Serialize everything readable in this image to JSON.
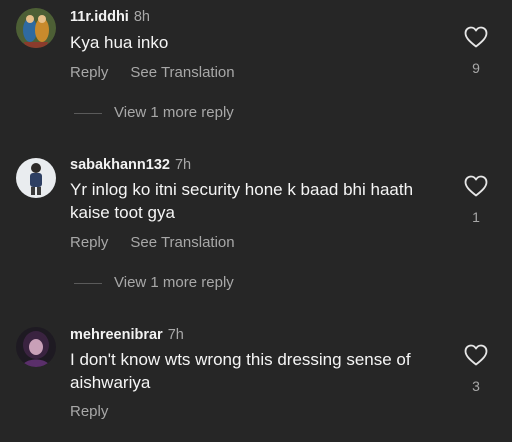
{
  "comments": [
    {
      "username": "11r.iddhi",
      "time": "8h",
      "text": "Kya hua inko",
      "reply_label": "Reply",
      "translate_label": "See Translation",
      "likes": "9",
      "view_replies": "View 1 more reply",
      "avatar_icon": "profile-photo"
    },
    {
      "username": "sabakhann132",
      "time": "7h",
      "text": "Yr inlog ko itni security hone k baad bhi haath kaise toot gya",
      "reply_label": "Reply",
      "translate_label": "See Translation",
      "likes": "1",
      "view_replies": "View 1 more reply",
      "avatar_icon": "profile-photo"
    },
    {
      "username": "mehreenibrar",
      "time": "7h",
      "text": "I don't know wts wrong this dressing sense of aishwariya",
      "reply_label": "Reply",
      "likes": "3",
      "avatar_icon": "profile-photo"
    }
  ],
  "colors": {
    "background": "#262626",
    "primary_text": "#f5f5f5",
    "secondary_text": "#a8a8a8"
  }
}
